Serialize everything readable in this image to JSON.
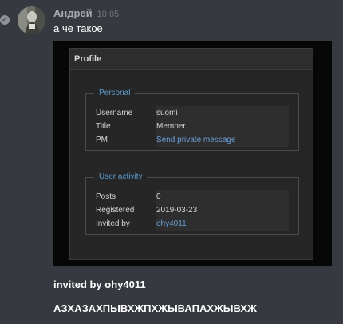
{
  "message": {
    "author": "Андрей",
    "timestamp": "10:05",
    "text": "а че такое"
  },
  "profile": {
    "title": "Profile",
    "personal": {
      "legend": "Personal",
      "rows": [
        {
          "label": "Username",
          "value": "suomi"
        },
        {
          "label": "Title",
          "value": "Member"
        },
        {
          "label": "PM",
          "value": "Send private message"
        }
      ]
    },
    "activity": {
      "legend": "User activity",
      "rows": [
        {
          "label": "Posts",
          "value": "0"
        },
        {
          "label": "Registered",
          "value": "2019-03-23"
        },
        {
          "label": "Invited by",
          "value": "ohy4011"
        }
      ]
    }
  },
  "followups": [
    "invited by ohy4011",
    "АЗХАЗАХПЫВХЖПХЖЫВАПАХЖЫВХЖ"
  ],
  "colors": {
    "background": "#36393f",
    "link": "#6b9fd8",
    "legend": "#5b9bd1"
  }
}
